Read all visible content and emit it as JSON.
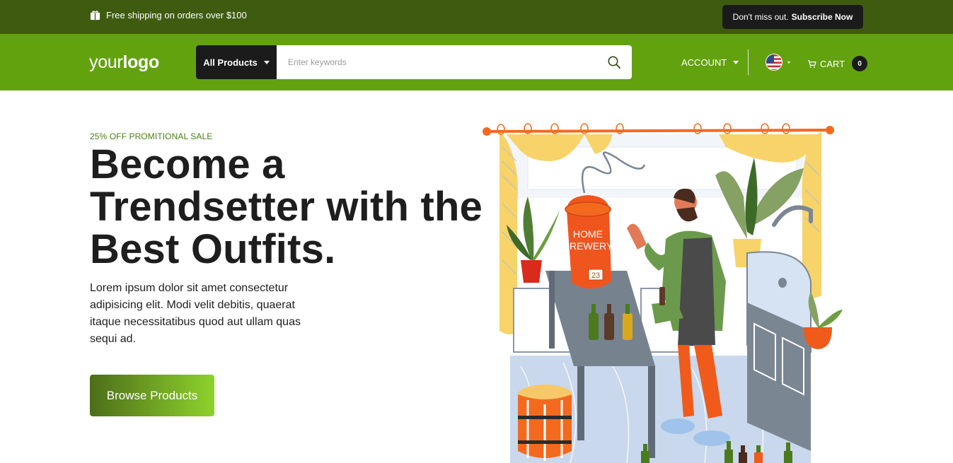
{
  "topbar": {
    "shipping_text": "Free shipping on orders over $100",
    "subscribe_prefix": "Don't miss out.",
    "subscribe_link": "Subscribe Now"
  },
  "header": {
    "logo_light": "your",
    "logo_bold": "logo",
    "category_label": "All Products",
    "search_placeholder": "Enter keywords",
    "search_value": "",
    "account_label": "ACCOUNT",
    "language_flag": "us-flag-icon",
    "cart_label": "CART",
    "cart_count": "0"
  },
  "hero": {
    "promo": "25% OFF PROMITIONAL SALE",
    "headline": "Become a Trendsetter with the Best Outfits.",
    "description": "Lorem ipsum dolor sit amet consectetur adipisicing elit. Modi velit debitis, quaerat itaque necessitatibus quod aut ullam quas sequi ad.",
    "cta_label": "Browse Products",
    "illustration_barrel_text": "HOME BREWERY",
    "illustration_barrel_number": "23"
  },
  "colors": {
    "topbar_bg": "#3f5b10",
    "header_bg": "#63a20f",
    "dark": "#1b1b1b",
    "promo_text": "#4b7e12",
    "cta_gradient_start": "#4d6e1a",
    "cta_gradient_end": "#8ed22c"
  }
}
